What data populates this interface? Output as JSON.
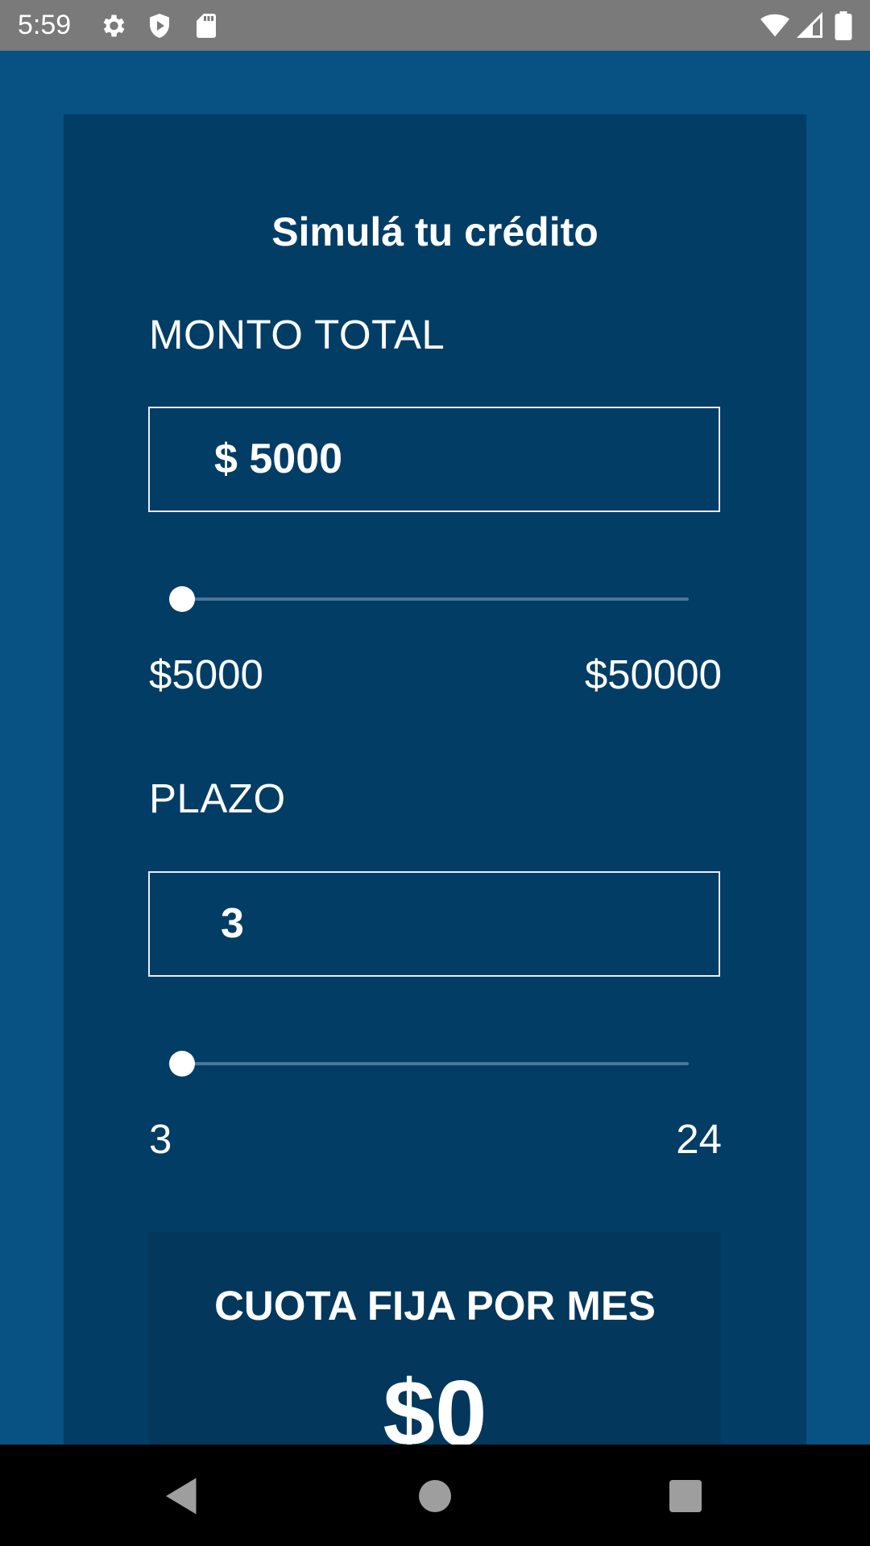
{
  "status_bar": {
    "time": "5:59",
    "icons_left": [
      "gear-icon",
      "shield-icon",
      "sd-card-icon"
    ],
    "icons_right": [
      "wifi-icon",
      "signal-icon",
      "battery-icon"
    ]
  },
  "simulator": {
    "title": "Simulá tu crédito",
    "amount": {
      "label": "MONTO TOTAL",
      "value": "$ 5000",
      "slider_fraction": 0.0,
      "min_label": "$5000",
      "max_label": "$50000"
    },
    "term": {
      "label": "PLAZO",
      "value": "3",
      "slider_fraction": 0.0,
      "min_label": "3",
      "max_label": "24"
    },
    "result": {
      "label": "CUOTA FIJA POR MES",
      "value": "$0"
    }
  },
  "nav_bar": {
    "buttons": [
      "back-icon",
      "home-icon",
      "recents-icon"
    ]
  },
  "colors": {
    "background": "#085183",
    "card": "#023d66",
    "result_panel": "#03375c",
    "status_bar": "#7a7a7a",
    "slider_track": "#4d7596"
  }
}
